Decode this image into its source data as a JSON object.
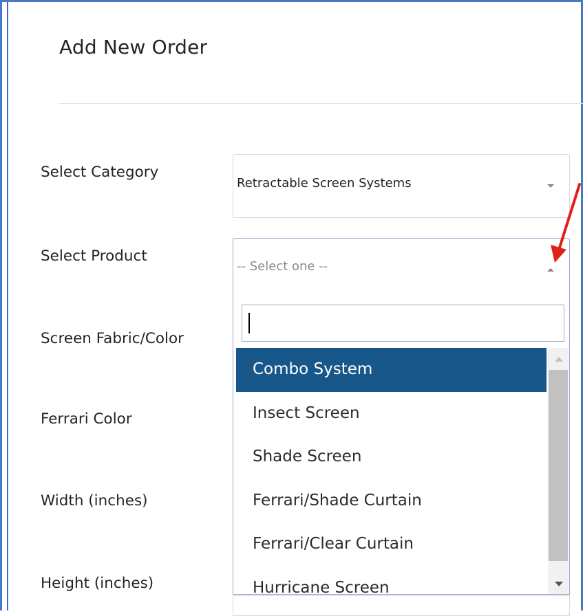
{
  "page": {
    "title": "Add New Order"
  },
  "form": {
    "category": {
      "label": "Select Category",
      "value": "Retractable Screen Systems"
    },
    "product": {
      "label": "Select Product",
      "placeholder": "-- Select one --"
    },
    "fabric": {
      "label": "Screen Fabric/Color"
    },
    "ferrari_color": {
      "label": "Ferrari Color"
    },
    "width": {
      "label": "Width (inches)"
    },
    "height": {
      "label": "Height (inches)"
    }
  },
  "dropdown": {
    "search_value": "",
    "options": [
      {
        "label": "Combo System",
        "selected": true
      },
      {
        "label": "Insect Screen",
        "selected": false
      },
      {
        "label": "Shade Screen",
        "selected": false
      },
      {
        "label": "Ferrari/Shade Curtain",
        "selected": false
      },
      {
        "label": "Ferrari/Clear Curtain",
        "selected": false
      },
      {
        "label": "Hurricane Screen",
        "selected": false
      }
    ]
  },
  "colors": {
    "accent_border": "#4a78c2",
    "highlight": "#18578a",
    "annotation_arrow": "#e0201b"
  }
}
